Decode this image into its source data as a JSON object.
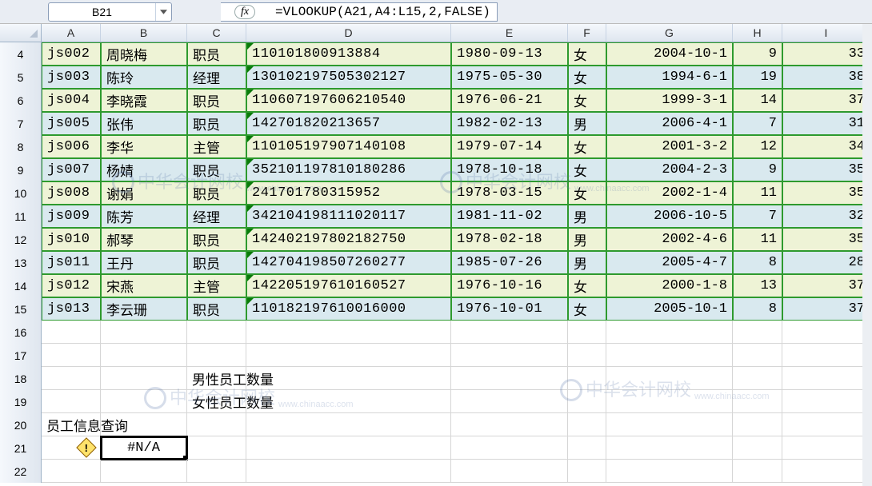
{
  "namebox": "B21",
  "fx_label": "fx",
  "formula": "=VLOOKUP(A21,A4:L15,2,FALSE)",
  "columns": [
    "A",
    "B",
    "C",
    "D",
    "E",
    "F",
    "G",
    "H",
    "I"
  ],
  "row_numbers": [
    4,
    5,
    6,
    7,
    8,
    9,
    10,
    11,
    12,
    13,
    14,
    15,
    16,
    17,
    18,
    19,
    20,
    21,
    22
  ],
  "rows": [
    {
      "a": "js002",
      "b": "周晓梅",
      "c": "职员",
      "d": "110101800913884",
      "e": "1980-09-13",
      "f": "女",
      "g": "2004-10-1",
      "h": "9",
      "i": "33"
    },
    {
      "a": "js003",
      "b": "陈玲",
      "c": "经理",
      "d": "130102197505302127",
      "e": "1975-05-30",
      "f": "女",
      "g": "1994-6-1",
      "h": "19",
      "i": "38"
    },
    {
      "a": "js004",
      "b": "李晓霞",
      "c": "职员",
      "d": "110607197606210540",
      "e": "1976-06-21",
      "f": "女",
      "g": "1999-3-1",
      "h": "14",
      "i": "37"
    },
    {
      "a": "js005",
      "b": "张伟",
      "c": "职员",
      "d": "142701820213657",
      "e": "1982-02-13",
      "f": "男",
      "g": "2006-4-1",
      "h": "7",
      "i": "31"
    },
    {
      "a": "js006",
      "b": "李华",
      "c": "主管",
      "d": "110105197907140108",
      "e": "1979-07-14",
      "f": "女",
      "g": "2001-3-2",
      "h": "12",
      "i": "34"
    },
    {
      "a": "js007",
      "b": "杨婧",
      "c": "职员",
      "d": "352101197810180286",
      "e": "1978-10-18",
      "f": "女",
      "g": "2004-2-3",
      "h": "9",
      "i": "35"
    },
    {
      "a": "js008",
      "b": "谢娟",
      "c": "职员",
      "d": "241701780315952",
      "e": "1978-03-15",
      "f": "女",
      "g": "2002-1-4",
      "h": "11",
      "i": "35"
    },
    {
      "a": "js009",
      "b": "陈芳",
      "c": "经理",
      "d": "342104198111020117",
      "e": "1981-11-02",
      "f": "男",
      "g": "2006-10-5",
      "h": "7",
      "i": "32"
    },
    {
      "a": "js010",
      "b": "郝琴",
      "c": "职员",
      "d": "142402197802182750",
      "e": "1978-02-18",
      "f": "男",
      "g": "2002-4-6",
      "h": "11",
      "i": "35"
    },
    {
      "a": "js011",
      "b": "王丹",
      "c": "职员",
      "d": "142704198507260277",
      "e": "1985-07-26",
      "f": "男",
      "g": "2005-4-7",
      "h": "8",
      "i": "28"
    },
    {
      "a": "js012",
      "b": "宋燕",
      "c": "主管",
      "d": "142205197610160527",
      "e": "1976-10-16",
      "f": "女",
      "g": "2000-1-8",
      "h": "13",
      "i": "37"
    },
    {
      "a": "js013",
      "b": "李云珊",
      "c": "职员",
      "d": "110182197610016000",
      "e": "1976-10-01",
      "f": "女",
      "g": "2005-10-1",
      "h": "8",
      "i": "37"
    }
  ],
  "labels": {
    "male_count": "男性员工数量",
    "female_count": "女性员工数量",
    "lookup_title": "员工信息查询"
  },
  "selected_value": "#N/A",
  "error_badge": "!",
  "watermark": {
    "text": "中华会计网校",
    "url": "www.chinaacc.com"
  }
}
